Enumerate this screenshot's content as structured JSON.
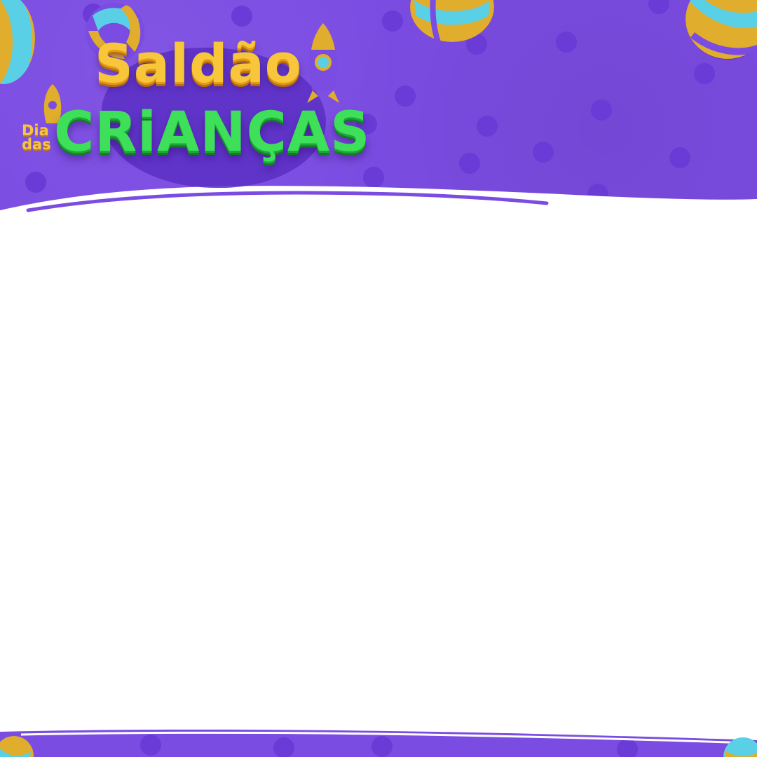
{
  "logo": {
    "saldao": "Saldão",
    "criancas": "CRiANÇAS",
    "dia": "Dia",
    "das": "das"
  },
  "colors": {
    "background_purple": "#7b4ce2",
    "polka_dot": "#6a3bd6",
    "content_area": "#ffffff",
    "saldao_text": "#f7c63b",
    "criancas_text": "#3ee05a",
    "ball_gold": "#e0ad2c",
    "ball_cyan": "#5ad0e6"
  },
  "decorations": {
    "balls": [
      "beach-ball-icon",
      "beach-ball-icon",
      "beach-ball-icon",
      "beach-ball-icon"
    ],
    "rockets": [
      "rocket-icon",
      "rocket-icon"
    ]
  }
}
